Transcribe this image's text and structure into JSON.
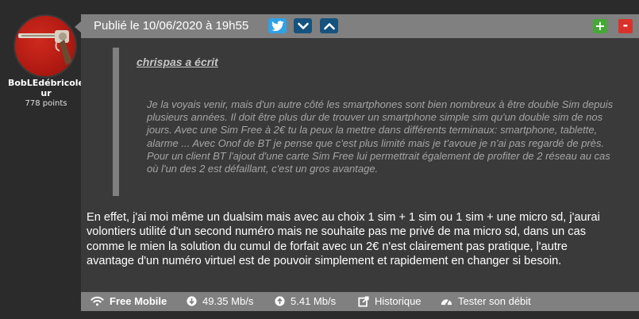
{
  "author": {
    "name": "BobLEdébricoleur",
    "points": "778 points"
  },
  "post": {
    "date": "Publié le 10/06/2020 à 19h55",
    "vote_plus": "+",
    "vote_minus": "-",
    "quote": {
      "author": "chrispas a écrit",
      "text": "Je la voyais venir, mais d'un autre côté les smartphones sont bien nombreux à être double Sim depuis plusieurs années. Il doit être plus dur de trouver un smartphone simple sim qu'un double sim de nos jours. Avec une Sim Free à 2€ tu la peux la mettre dans différents terminaux: smartphone, tablette, alarme ... Avec Onof de BT je pense que c'est plus limité mais je t'avoue je n'ai pas regardé de près. Pour un client BT l'ajout d'une carte Sim Free lui permettrait également de profiter de 2 réseau au cas où l'un des 2 est défaillant, c'est un gros avantage."
    },
    "text": "En effet, j'ai moi même un dualsim mais avec au choix 1 sim + 1 sim ou 1 sim + une micro sd, j'aurai volontiers utilité d'un second numéro mais ne souhaite pas me privé de ma micro sd, dans un cas comme le mien la solution du cumul de forfait avec un 2€ n'est clairement pas pratique, l'autre avantage d'un numéro virtuel est de pouvoir simplement et rapidement en changer si besoin."
  },
  "footer": {
    "isp": "Free Mobile",
    "download": "49.35 Mb/s",
    "upload": "5.41 Mb/s",
    "history": "Historique",
    "test": "Tester son débit"
  },
  "icons": {
    "twitter": "twitter-icon",
    "down": "chevron-down-icon",
    "up": "chevron-up-icon",
    "wifi": "wifi-icon",
    "download": "download-arrow-icon",
    "upload": "upload-arrow-icon",
    "history": "external-link-icon",
    "test": "speedometer-icon"
  },
  "colors": {
    "background": "#2b2b2b",
    "header": "#808080",
    "body": "#3a3a3a",
    "twitter": "#2fa2e8",
    "nav_button": "#16527e",
    "plus": "#46a836",
    "minus": "#d9322b"
  }
}
